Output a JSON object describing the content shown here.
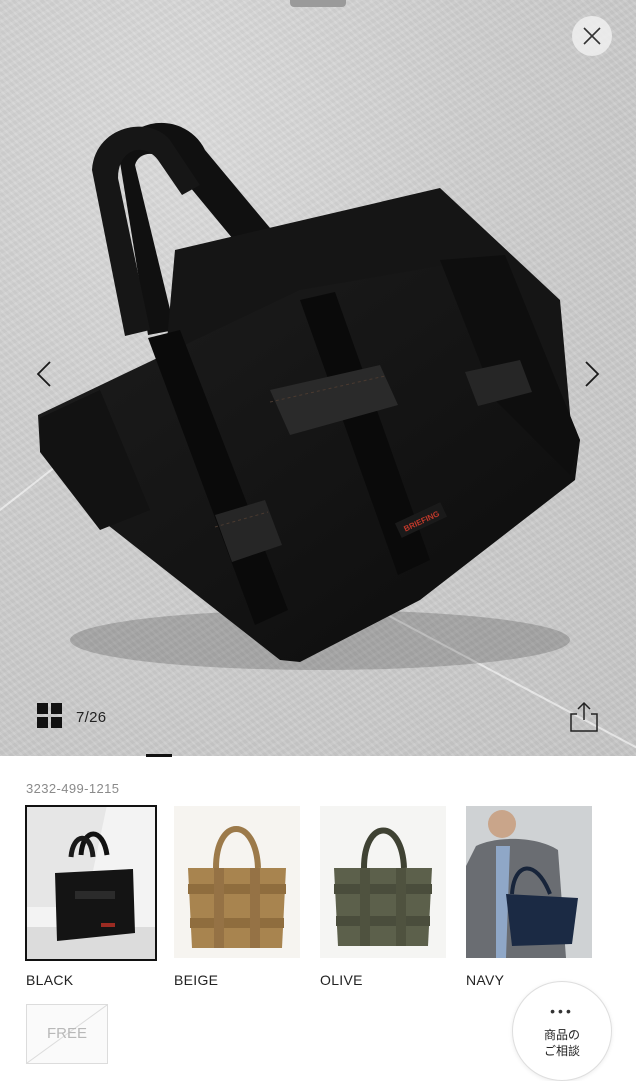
{
  "gallery": {
    "counter": "7/26",
    "brand_tag": "BRIEFING"
  },
  "product": {
    "code": "3232-499-1215"
  },
  "colors": [
    {
      "label": "BLACK",
      "selected": true
    },
    {
      "label": "BEIGE",
      "selected": false
    },
    {
      "label": "OLIVE",
      "selected": false
    },
    {
      "label": "NAVY",
      "selected": false
    }
  ],
  "size": {
    "label": "FREE",
    "available": false
  },
  "consult": {
    "line1": "商品の",
    "line2": "ご相談"
  },
  "icons": {
    "close": "close-icon",
    "prev": "chevron-left-icon",
    "next": "chevron-right-icon",
    "grid": "grid-icon",
    "share": "share-icon",
    "more": "more-dots-icon"
  },
  "theme": {
    "accent": "#111111",
    "brand_red": "#c0392b",
    "muted_text": "#8a8a8a"
  }
}
